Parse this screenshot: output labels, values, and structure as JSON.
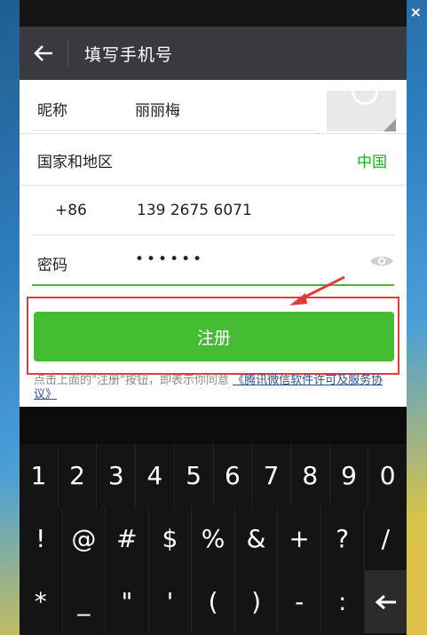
{
  "header": {
    "title": "填写手机号"
  },
  "form": {
    "nickname_label": "昵称",
    "nickname_value": "丽丽梅",
    "country_label": "国家和地区",
    "country_value": "中国",
    "country_code": "+86",
    "phone_value": "139 2675 6071",
    "password_label": "密码",
    "password_value": "••••••"
  },
  "register_button": "注册",
  "agreement": {
    "prefix": "点击上面的\"注册\"按钮，即表示你同意",
    "link": "《腾讯微信软件许可及服务协议》"
  },
  "keyboard": {
    "row1": [
      "1",
      "2",
      "3",
      "4",
      "5",
      "6",
      "7",
      "8",
      "9",
      "0"
    ],
    "row2": [
      "!",
      "@",
      "#",
      "$",
      "%",
      "&",
      "+",
      "?",
      "/"
    ],
    "row3": [
      "*",
      "_",
      "\"",
      "'",
      "(",
      ")",
      "-",
      ":"
    ]
  },
  "colors": {
    "accent": "#44bd32",
    "country": "#1aad19",
    "header": "#393a3f",
    "highlight": "#e23b3b"
  },
  "icons": {
    "back": "arrow-left",
    "eye": "eye",
    "backspace": "arrow-left",
    "close": "x"
  }
}
